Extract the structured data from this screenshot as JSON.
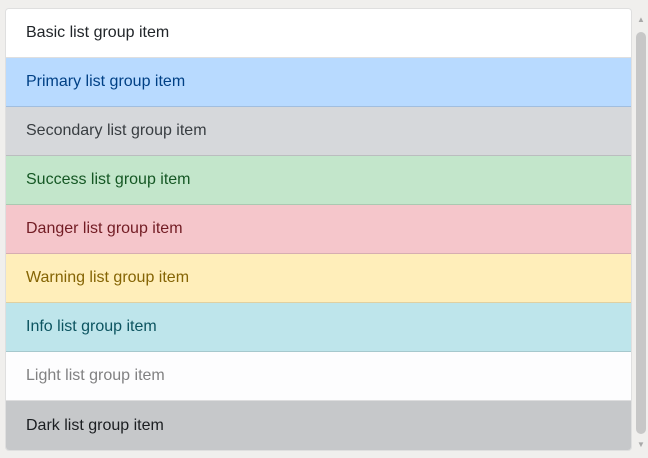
{
  "list_items": [
    {
      "label": "Basic list group item",
      "bg": "#ffffff",
      "fg": "#212529"
    },
    {
      "label": "Primary list group item",
      "bg": "#b8daff",
      "fg": "#004085"
    },
    {
      "label": "Secondary list group item",
      "bg": "#d6d8db",
      "fg": "#383d41"
    },
    {
      "label": "Success list group item",
      "bg": "#c3e6cb",
      "fg": "#155724"
    },
    {
      "label": "Danger list group item",
      "bg": "#f5c6cb",
      "fg": "#721c24"
    },
    {
      "label": "Warning list group item",
      "bg": "#ffeeba",
      "fg": "#856404"
    },
    {
      "label": "Info list group item",
      "bg": "#bee5eb",
      "fg": "#0c5460"
    },
    {
      "label": "Light list group item",
      "bg": "#fdfdfe",
      "fg": "#818182"
    },
    {
      "label": "Dark list group item",
      "bg": "#c6c8ca",
      "fg": "#1b1e21"
    }
  ],
  "scrollbar": {
    "up_icon": "▲",
    "down_icon": "▼"
  }
}
